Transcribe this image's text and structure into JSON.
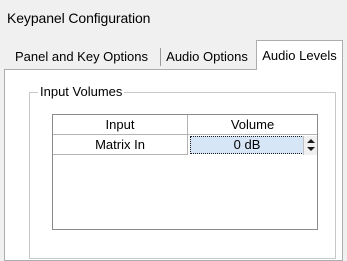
{
  "window": {
    "title": "Keypanel Configuration"
  },
  "tabs": [
    {
      "label": "Panel and Key Options",
      "selected": false
    },
    {
      "label": "Audio Options",
      "selected": false
    },
    {
      "label": "Audio Levels",
      "selected": true
    }
  ],
  "input_volumes": {
    "group_label": "Input Volumes",
    "columns": [
      "Input",
      "Volume"
    ],
    "rows": [
      {
        "input": "Matrix In",
        "volume": "0 dB"
      }
    ]
  },
  "icons": {
    "spinner_up": "spinner-up-arrow-icon",
    "spinner_down": "spinner-down-arrow-icon"
  }
}
